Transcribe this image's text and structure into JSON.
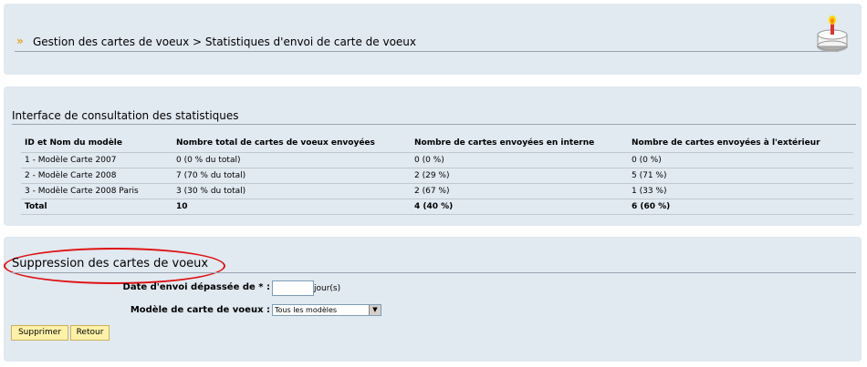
{
  "header": {
    "breadcrumb": "Gestion des cartes de voeux > Statistiques d'envoi de carte de voeux",
    "arrows": "»",
    "icon": "birthday-cake-icon"
  },
  "stats": {
    "title": "Interface de consultation des statistiques",
    "columns": [
      "ID et Nom du modèle",
      "Nombre total de cartes de voeux envoyées",
      "Nombre de cartes envoyées en interne",
      "Nombre de cartes envoyées à l'extérieur"
    ],
    "rows": [
      [
        "1 - Modèle Carte 2007",
        "0 (0 % du total)",
        "0 (0 %)",
        "0 (0 %)"
      ],
      [
        "2 - Modèle Carte 2008",
        "7 (70 % du total)",
        "2 (29 %)",
        "5 (71 %)"
      ],
      [
        "3 - Modèle Carte 2008 Paris",
        "3 (30 % du total)",
        "2 (67 %)",
        "1 (33 %)"
      ]
    ],
    "total": [
      "Total",
      "10",
      "4 (40 %)",
      "6 (60 %)"
    ]
  },
  "deletion": {
    "title": "Suppression des cartes de voeux",
    "date_label": "Date d'envoi dépassée de * :",
    "date_value": "",
    "date_unit": "jour(s)",
    "model_label": "Modèle de carte de voeux :",
    "model_selected": "Tous les modèles",
    "delete_button": "Supprimer",
    "back_button": "Retour"
  },
  "colors": {
    "panel_bg": "#e1e9f1",
    "highlight_ellipse": "#e01010",
    "button_bg": "#fff2a8"
  }
}
